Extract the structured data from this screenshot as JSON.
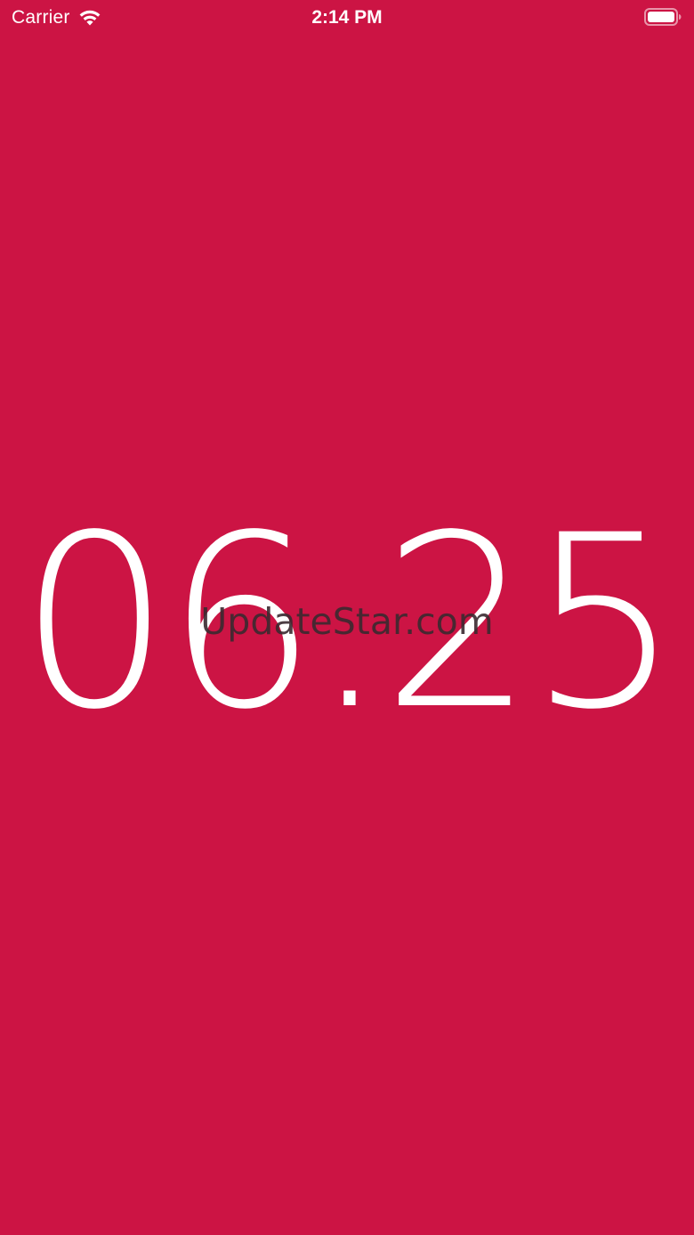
{
  "status_bar": {
    "carrier": "Carrier",
    "time": "2:14 PM",
    "wifi_icon": "wifi-icon",
    "battery_icon": "battery-full-icon"
  },
  "timer": {
    "value": "06.25"
  },
  "watermark": {
    "text": "UpdateStar.com"
  },
  "colors": {
    "background": "#cc1444",
    "foreground": "#ffffff"
  }
}
